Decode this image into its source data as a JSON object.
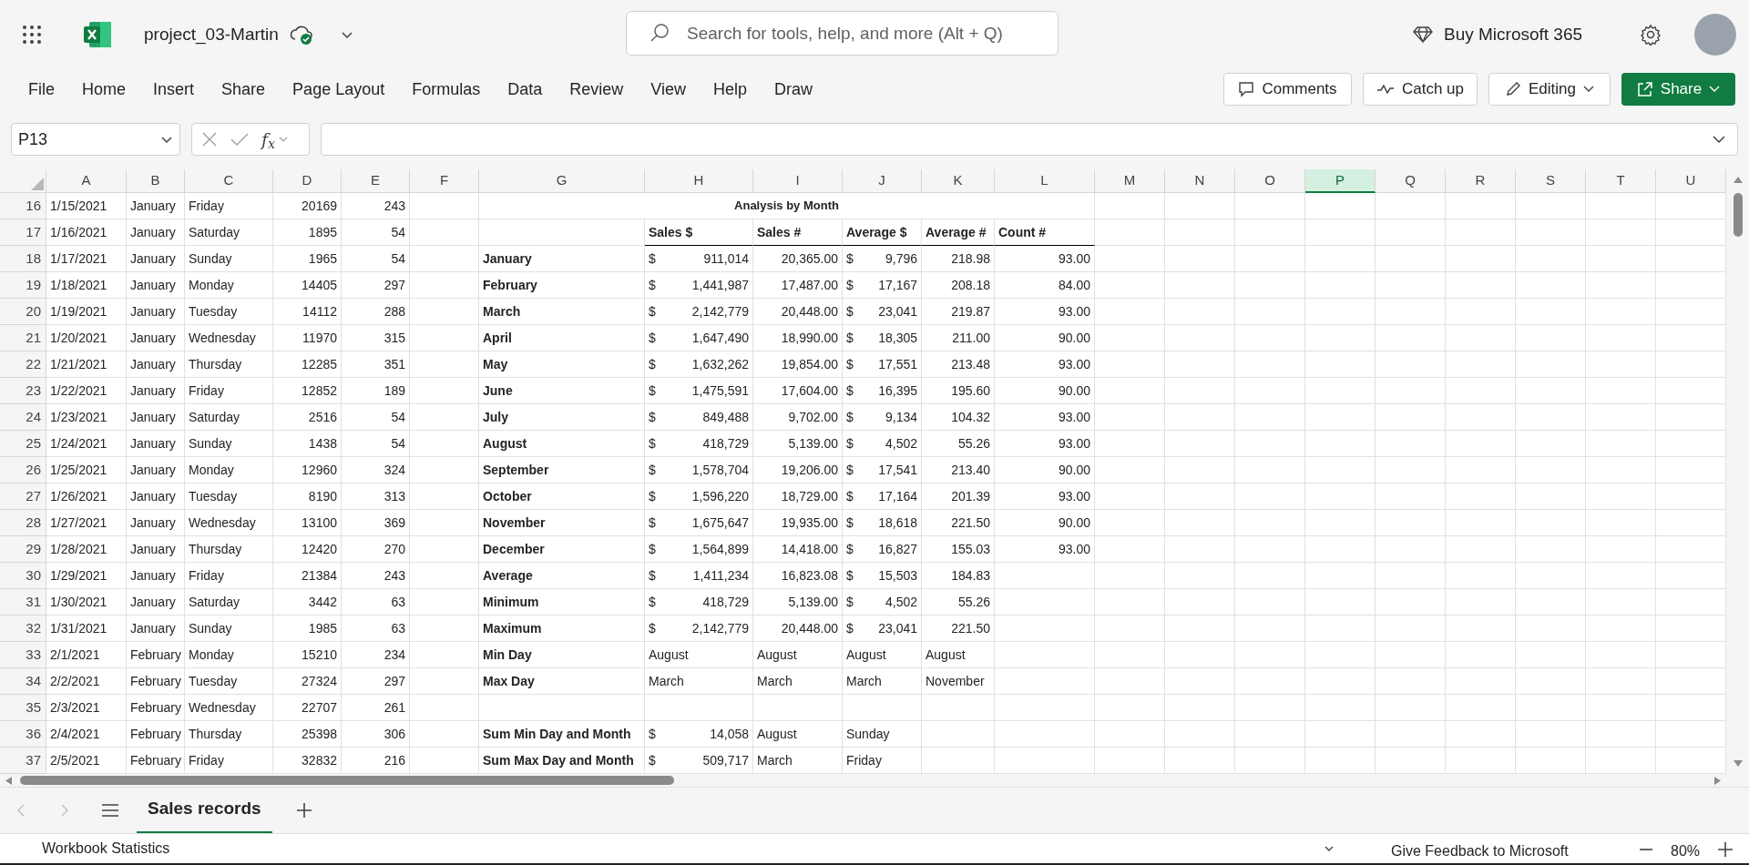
{
  "title_bar": {
    "file_name": "project_03-Martin",
    "search_placeholder": "Search for tools, help, and more (Alt + Q)",
    "buy_label": "Buy Microsoft 365"
  },
  "menu": [
    "File",
    "Home",
    "Insert",
    "Share",
    "Page Layout",
    "Formulas",
    "Data",
    "Review",
    "View",
    "Help",
    "Draw"
  ],
  "actions": [
    {
      "kind": "comments",
      "label": "Comments"
    },
    {
      "kind": "catchup",
      "label": "Catch up"
    },
    {
      "kind": "editing",
      "label": "Editing"
    },
    {
      "kind": "share",
      "label": "Share"
    }
  ],
  "formula_bar": {
    "name_box": "P13",
    "function_label": "f$_{x}$"
  },
  "columns": [
    {
      "letter": "A",
      "selected": false
    },
    {
      "letter": "B",
      "selected": false
    },
    {
      "letter": "C",
      "selected": false
    },
    {
      "letter": "D",
      "selected": false
    },
    {
      "letter": "E",
      "selected": false
    },
    {
      "letter": "F",
      "selected": false
    },
    {
      "letter": "G",
      "selected": false
    },
    {
      "letter": "H",
      "selected": false
    },
    {
      "letter": "I",
      "selected": false
    },
    {
      "letter": "J",
      "selected": false
    },
    {
      "letter": "K",
      "selected": false
    },
    {
      "letter": "L",
      "selected": false
    },
    {
      "letter": "M",
      "selected": false
    },
    {
      "letter": "N",
      "selected": false
    },
    {
      "letter": "O",
      "selected": false
    },
    {
      "letter": "P",
      "selected": true
    },
    {
      "letter": "Q",
      "selected": false
    },
    {
      "letter": "R",
      "selected": false
    },
    {
      "letter": "S",
      "selected": false
    },
    {
      "letter": "T",
      "selected": false
    },
    {
      "letter": "U",
      "selected": false
    }
  ],
  "rows": [
    {
      "number": "16",
      "cells": {
        "a": {
          "kind": "text",
          "text": "1/15/2021"
        },
        "b": {
          "kind": "text",
          "text": "January"
        },
        "c": {
          "kind": "text",
          "text": "Friday"
        },
        "d": {
          "kind": "number",
          "text": "20169"
        },
        "e": {
          "kind": "number",
          "text": "243"
        },
        "g": {
          "kind": "title",
          "text": "Analysis by Month"
        }
      }
    },
    {
      "number": "17",
      "cells": {
        "a": {
          "kind": "text",
          "text": "1/16/2021"
        },
        "b": {
          "kind": "text",
          "text": "January"
        },
        "c": {
          "kind": "text",
          "text": "Saturday"
        },
        "d": {
          "kind": "number",
          "text": "1895"
        },
        "e": {
          "kind": "number",
          "text": "54"
        },
        "h": {
          "kind": "header",
          "text": "Sales $"
        },
        "i": {
          "kind": "header",
          "text": "Sales #"
        },
        "j": {
          "kind": "header",
          "text": "Average $"
        },
        "k": {
          "kind": "header",
          "text": "Average #"
        },
        "l": {
          "kind": "header",
          "text": "Count #"
        }
      }
    },
    {
      "number": "18",
      "cells": {
        "a": {
          "kind": "text",
          "text": "1/17/2021"
        },
        "b": {
          "kind": "text",
          "text": "January"
        },
        "c": {
          "kind": "text",
          "text": "Sunday"
        },
        "d": {
          "kind": "number",
          "text": "1965"
        },
        "e": {
          "kind": "number",
          "text": "54"
        },
        "g": {
          "kind": "label",
          "text": "January"
        },
        "h": {
          "kind": "currency",
          "symbol": "$",
          "text": "911,014"
        },
        "i": {
          "kind": "number",
          "text": "20,365.00"
        },
        "j": {
          "kind": "currency",
          "symbol": "$",
          "text": "9,796"
        },
        "k": {
          "kind": "number",
          "text": "218.98"
        },
        "l": {
          "kind": "number",
          "text": "93.00"
        }
      }
    },
    {
      "number": "19",
      "cells": {
        "a": {
          "kind": "text",
          "text": "1/18/2021"
        },
        "b": {
          "kind": "text",
          "text": "January"
        },
        "c": {
          "kind": "text",
          "text": "Monday"
        },
        "d": {
          "kind": "number",
          "text": "14405"
        },
        "e": {
          "kind": "number",
          "text": "297"
        },
        "g": {
          "kind": "label",
          "text": "February"
        },
        "h": {
          "kind": "currency",
          "symbol": "$",
          "text": "1,441,987"
        },
        "i": {
          "kind": "number",
          "text": "17,487.00"
        },
        "j": {
          "kind": "currency",
          "symbol": "$",
          "text": "17,167"
        },
        "k": {
          "kind": "number",
          "text": "208.18"
        },
        "l": {
          "kind": "number",
          "text": "84.00"
        }
      }
    },
    {
      "number": "20",
      "cells": {
        "a": {
          "kind": "text",
          "text": "1/19/2021"
        },
        "b": {
          "kind": "text",
          "text": "January"
        },
        "c": {
          "kind": "text",
          "text": "Tuesday"
        },
        "d": {
          "kind": "number",
          "text": "14112"
        },
        "e": {
          "kind": "number",
          "text": "288"
        },
        "g": {
          "kind": "label",
          "text": "March"
        },
        "h": {
          "kind": "currency",
          "symbol": "$",
          "text": "2,142,779"
        },
        "i": {
          "kind": "number",
          "text": "20,448.00"
        },
        "j": {
          "kind": "currency",
          "symbol": "$",
          "text": "23,041"
        },
        "k": {
          "kind": "number",
          "text": "219.87"
        },
        "l": {
          "kind": "number",
          "text": "93.00"
        }
      }
    },
    {
      "number": "21",
      "cells": {
        "a": {
          "kind": "text",
          "text": "1/20/2021"
        },
        "b": {
          "kind": "text",
          "text": "January"
        },
        "c": {
          "kind": "text",
          "text": "Wednesday"
        },
        "d": {
          "kind": "number",
          "text": "11970"
        },
        "e": {
          "kind": "number",
          "text": "315"
        },
        "g": {
          "kind": "label",
          "text": "April"
        },
        "h": {
          "kind": "currency",
          "symbol": "$",
          "text": "1,647,490"
        },
        "i": {
          "kind": "number",
          "text": "18,990.00"
        },
        "j": {
          "kind": "currency",
          "symbol": "$",
          "text": "18,305"
        },
        "k": {
          "kind": "number",
          "text": "211.00"
        },
        "l": {
          "kind": "number",
          "text": "90.00"
        }
      }
    },
    {
      "number": "22",
      "cells": {
        "a": {
          "kind": "text",
          "text": "1/21/2021"
        },
        "b": {
          "kind": "text",
          "text": "January"
        },
        "c": {
          "kind": "text",
          "text": "Thursday"
        },
        "d": {
          "kind": "number",
          "text": "12285"
        },
        "e": {
          "kind": "number",
          "text": "351"
        },
        "g": {
          "kind": "label",
          "text": "May"
        },
        "h": {
          "kind": "currency",
          "symbol": "$",
          "text": "1,632,262"
        },
        "i": {
          "kind": "number",
          "text": "19,854.00"
        },
        "j": {
          "kind": "currency",
          "symbol": "$",
          "text": "17,551"
        },
        "k": {
          "kind": "number",
          "text": "213.48"
        },
        "l": {
          "kind": "number",
          "text": "93.00"
        }
      }
    },
    {
      "number": "23",
      "cells": {
        "a": {
          "kind": "text",
          "text": "1/22/2021"
        },
        "b": {
          "kind": "text",
          "text": "January"
        },
        "c": {
          "kind": "text",
          "text": "Friday"
        },
        "d": {
          "kind": "number",
          "text": "12852"
        },
        "e": {
          "kind": "number",
          "text": "189"
        },
        "g": {
          "kind": "label",
          "text": "June"
        },
        "h": {
          "kind": "currency",
          "symbol": "$",
          "text": "1,475,591"
        },
        "i": {
          "kind": "number",
          "text": "17,604.00"
        },
        "j": {
          "kind": "currency",
          "symbol": "$",
          "text": "16,395"
        },
        "k": {
          "kind": "number",
          "text": "195.60"
        },
        "l": {
          "kind": "number",
          "text": "90.00"
        }
      }
    },
    {
      "number": "24",
      "cells": {
        "a": {
          "kind": "text",
          "text": "1/23/2021"
        },
        "b": {
          "kind": "text",
          "text": "January"
        },
        "c": {
          "kind": "text",
          "text": "Saturday"
        },
        "d": {
          "kind": "number",
          "text": "2516"
        },
        "e": {
          "kind": "number",
          "text": "54"
        },
        "g": {
          "kind": "label",
          "text": "July"
        },
        "h": {
          "kind": "currency",
          "symbol": "$",
          "text": "849,488"
        },
        "i": {
          "kind": "number",
          "text": "9,702.00"
        },
        "j": {
          "kind": "currency",
          "symbol": "$",
          "text": "9,134"
        },
        "k": {
          "kind": "number",
          "text": "104.32"
        },
        "l": {
          "kind": "number",
          "text": "93.00"
        }
      }
    },
    {
      "number": "25",
      "cells": {
        "a": {
          "kind": "text",
          "text": "1/24/2021"
        },
        "b": {
          "kind": "text",
          "text": "January"
        },
        "c": {
          "kind": "text",
          "text": "Sunday"
        },
        "d": {
          "kind": "number",
          "text": "1438"
        },
        "e": {
          "kind": "number",
          "text": "54"
        },
        "g": {
          "kind": "label",
          "text": "August"
        },
        "h": {
          "kind": "currency",
          "symbol": "$",
          "text": "418,729"
        },
        "i": {
          "kind": "number",
          "text": "5,139.00"
        },
        "j": {
          "kind": "currency",
          "symbol": "$",
          "text": "4,502"
        },
        "k": {
          "kind": "number",
          "text": "55.26"
        },
        "l": {
          "kind": "number",
          "text": "93.00"
        }
      }
    },
    {
      "number": "26",
      "cells": {
        "a": {
          "kind": "text",
          "text": "1/25/2021"
        },
        "b": {
          "kind": "text",
          "text": "January"
        },
        "c": {
          "kind": "text",
          "text": "Monday"
        },
        "d": {
          "kind": "number",
          "text": "12960"
        },
        "e": {
          "kind": "number",
          "text": "324"
        },
        "g": {
          "kind": "label",
          "text": "September"
        },
        "h": {
          "kind": "currency",
          "symbol": "$",
          "text": "1,578,704"
        },
        "i": {
          "kind": "number",
          "text": "19,206.00"
        },
        "j": {
          "kind": "currency",
          "symbol": "$",
          "text": "17,541"
        },
        "k": {
          "kind": "number",
          "text": "213.40"
        },
        "l": {
          "kind": "number",
          "text": "90.00"
        }
      }
    },
    {
      "number": "27",
      "cells": {
        "a": {
          "kind": "text",
          "text": "1/26/2021"
        },
        "b": {
          "kind": "text",
          "text": "January"
        },
        "c": {
          "kind": "text",
          "text": "Tuesday"
        },
        "d": {
          "kind": "number",
          "text": "8190"
        },
        "e": {
          "kind": "number",
          "text": "313"
        },
        "g": {
          "kind": "label",
          "text": "October"
        },
        "h": {
          "kind": "currency",
          "symbol": "$",
          "text": "1,596,220"
        },
        "i": {
          "kind": "number",
          "text": "18,729.00"
        },
        "j": {
          "kind": "currency",
          "symbol": "$",
          "text": "17,164"
        },
        "k": {
          "kind": "number",
          "text": "201.39"
        },
        "l": {
          "kind": "number",
          "text": "93.00"
        }
      }
    },
    {
      "number": "28",
      "cells": {
        "a": {
          "kind": "text",
          "text": "1/27/2021"
        },
        "b": {
          "kind": "text",
          "text": "January"
        },
        "c": {
          "kind": "text",
          "text": "Wednesday"
        },
        "d": {
          "kind": "number",
          "text": "13100"
        },
        "e": {
          "kind": "number",
          "text": "369"
        },
        "g": {
          "kind": "label",
          "text": "November"
        },
        "h": {
          "kind": "currency",
          "symbol": "$",
          "text": "1,675,647"
        },
        "i": {
          "kind": "number",
          "text": "19,935.00"
        },
        "j": {
          "kind": "currency",
          "symbol": "$",
          "text": "18,618"
        },
        "k": {
          "kind": "number",
          "text": "221.50"
        },
        "l": {
          "kind": "number",
          "text": "90.00"
        }
      }
    },
    {
      "number": "29",
      "cells": {
        "a": {
          "kind": "text",
          "text": "1/28/2021"
        },
        "b": {
          "kind": "text",
          "text": "January"
        },
        "c": {
          "kind": "text",
          "text": "Thursday"
        },
        "d": {
          "kind": "number",
          "text": "12420"
        },
        "e": {
          "kind": "number",
          "text": "270"
        },
        "g": {
          "kind": "label",
          "text": "December"
        },
        "h": {
          "kind": "currency",
          "symbol": "$",
          "text": "1,564,899"
        },
        "i": {
          "kind": "number",
          "text": "14,418.00"
        },
        "j": {
          "kind": "currency",
          "symbol": "$",
          "text": "16,827"
        },
        "k": {
          "kind": "number",
          "text": "155.03"
        },
        "l": {
          "kind": "number",
          "text": "93.00"
        }
      }
    },
    {
      "number": "30",
      "cells": {
        "a": {
          "kind": "text",
          "text": "1/29/2021"
        },
        "b": {
          "kind": "text",
          "text": "January"
        },
        "c": {
          "kind": "text",
          "text": "Friday"
        },
        "d": {
          "kind": "number",
          "text": "21384"
        },
        "e": {
          "kind": "number",
          "text": "243"
        },
        "g": {
          "kind": "label",
          "text": "Average"
        },
        "h": {
          "kind": "currency",
          "symbol": "$",
          "text": "1,411,234"
        },
        "i": {
          "kind": "number",
          "text": "16,823.08"
        },
        "j": {
          "kind": "currency",
          "symbol": "$",
          "text": "15,503"
        },
        "k": {
          "kind": "number",
          "text": "184.83"
        }
      }
    },
    {
      "number": "31",
      "cells": {
        "a": {
          "kind": "text",
          "text": "1/30/2021"
        },
        "b": {
          "kind": "text",
          "text": "January"
        },
        "c": {
          "kind": "text",
          "text": "Saturday"
        },
        "d": {
          "kind": "number",
          "text": "3442"
        },
        "e": {
          "kind": "number",
          "text": "63"
        },
        "g": {
          "kind": "label",
          "text": "Minimum"
        },
        "h": {
          "kind": "currency",
          "symbol": "$",
          "text": "418,729"
        },
        "i": {
          "kind": "number",
          "text": "5,139.00"
        },
        "j": {
          "kind": "currency",
          "symbol": "$",
          "text": "4,502"
        },
        "k": {
          "kind": "number",
          "text": "55.26"
        }
      }
    },
    {
      "number": "32",
      "cells": {
        "a": {
          "kind": "text",
          "text": "1/31/2021"
        },
        "b": {
          "kind": "text",
          "text": "January"
        },
        "c": {
          "kind": "text",
          "text": "Sunday"
        },
        "d": {
          "kind": "number",
          "text": "1985"
        },
        "e": {
          "kind": "number",
          "text": "63"
        },
        "g": {
          "kind": "label",
          "text": "Maximum"
        },
        "h": {
          "kind": "currency",
          "symbol": "$",
          "text": "2,142,779"
        },
        "i": {
          "kind": "number",
          "text": "20,448.00"
        },
        "j": {
          "kind": "currency",
          "symbol": "$",
          "text": "23,041"
        },
        "k": {
          "kind": "number",
          "text": "221.50"
        }
      }
    },
    {
      "number": "33",
      "cells": {
        "a": {
          "kind": "text",
          "text": "2/1/2021"
        },
        "b": {
          "kind": "text",
          "text": "February"
        },
        "c": {
          "kind": "text",
          "text": "Monday"
        },
        "d": {
          "kind": "number",
          "text": "15210"
        },
        "e": {
          "kind": "number",
          "text": "234"
        },
        "g": {
          "kind": "label",
          "text": "Min Day"
        },
        "h": {
          "kind": "text",
          "text": "August"
        },
        "i": {
          "kind": "text",
          "text": "August"
        },
        "j": {
          "kind": "text",
          "text": "August"
        },
        "k": {
          "kind": "text",
          "text": "August"
        }
      }
    },
    {
      "number": "34",
      "cells": {
        "a": {
          "kind": "text",
          "text": "2/2/2021"
        },
        "b": {
          "kind": "text",
          "text": "February"
        },
        "c": {
          "kind": "text",
          "text": "Tuesday"
        },
        "d": {
          "kind": "number",
          "text": "27324"
        },
        "e": {
          "kind": "number",
          "text": "297"
        },
        "g": {
          "kind": "label",
          "text": "Max Day"
        },
        "h": {
          "kind": "text",
          "text": "March"
        },
        "i": {
          "kind": "text",
          "text": "March"
        },
        "j": {
          "kind": "text",
          "text": "March"
        },
        "k": {
          "kind": "text",
          "text": "November"
        }
      }
    },
    {
      "number": "35",
      "cells": {
        "a": {
          "kind": "text",
          "text": "2/3/2021"
        },
        "b": {
          "kind": "text",
          "text": "February"
        },
        "c": {
          "kind": "text",
          "text": "Wednesday"
        },
        "d": {
          "kind": "number",
          "text": "22707"
        },
        "e": {
          "kind": "number",
          "text": "261"
        }
      }
    },
    {
      "number": "36",
      "cells": {
        "a": {
          "kind": "text",
          "text": "2/4/2021"
        },
        "b": {
          "kind": "text",
          "text": "February"
        },
        "c": {
          "kind": "text",
          "text": "Thursday"
        },
        "d": {
          "kind": "number",
          "text": "25398"
        },
        "e": {
          "kind": "number",
          "text": "306"
        },
        "g": {
          "kind": "label",
          "text": "Sum Min Day and Month"
        },
        "h": {
          "kind": "currency",
          "symbol": "$",
          "text": "14,058"
        },
        "i": {
          "kind": "text",
          "text": "August"
        },
        "j": {
          "kind": "text",
          "text": "Sunday"
        }
      }
    },
    {
      "number": "37",
      "cells": {
        "a": {
          "kind": "text",
          "text": "2/5/2021"
        },
        "b": {
          "kind": "text",
          "text": "February"
        },
        "c": {
          "kind": "text",
          "text": "Friday"
        },
        "d": {
          "kind": "number",
          "text": "32832"
        },
        "e": {
          "kind": "number",
          "text": "216"
        },
        "g": {
          "kind": "label",
          "text": "Sum Max Day and Month"
        },
        "h": {
          "kind": "currency",
          "symbol": "$",
          "text": "509,717"
        },
        "i": {
          "kind": "text",
          "text": "March"
        },
        "j": {
          "kind": "text",
          "text": "Friday"
        }
      }
    }
  ],
  "sheet_tabs": [
    {
      "label": "Sales records",
      "selected": true
    }
  ],
  "status_bar": {
    "left": "Workbook Statistics",
    "feedback": "Give Feedback to Microsoft",
    "zoom": "80%"
  }
}
